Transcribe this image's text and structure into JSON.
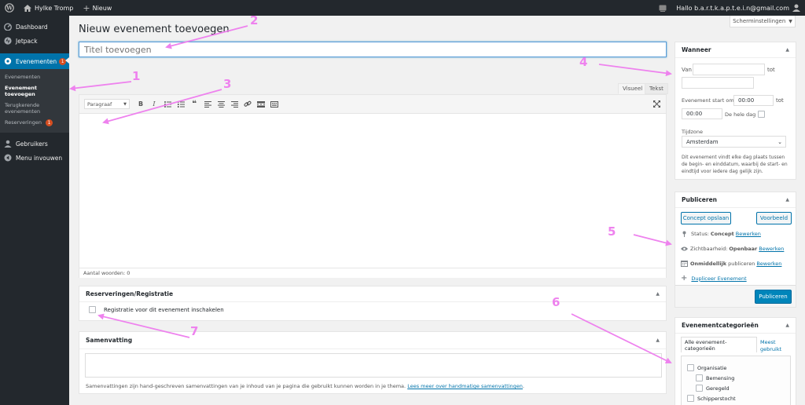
{
  "admin_bar": {
    "site_name": "Hylke Tromp",
    "new_label": "Nieuw",
    "greeting": "Hallo b.a.r.t.k.a.p.t.e.i.n@gmail.com"
  },
  "sidebar": {
    "items": [
      {
        "label": "Dashboard"
      },
      {
        "label": "Jetpack"
      },
      {
        "label": "Evenementen",
        "badge": "1"
      },
      {
        "label": "Gebruikers"
      },
      {
        "label": "Menu invouwen"
      }
    ],
    "submenu": [
      {
        "label": "Evenementen"
      },
      {
        "label": "Evenement toevoegen"
      },
      {
        "label": "Terugkerende evenementen"
      },
      {
        "label": "Reserveringen",
        "badge": "1"
      }
    ]
  },
  "main": {
    "page_title": "Nieuw evenement toevoegen",
    "screen_options": "Scherminstellingen",
    "title_placeholder": "Titel toevoegen"
  },
  "editor": {
    "tab_visual": "Visueel",
    "tab_text": "Tekst",
    "format": "Paragraaf",
    "word_count": "Aantal woorden: 0"
  },
  "reservations_box": {
    "title": "Reserveringen/Registratie",
    "checkbox_label": "Registratie voor dit evenement inschakelen"
  },
  "summary_box": {
    "title": "Samenvatting",
    "help_text": "Samenvattingen zijn hand-geschreven samenvattingen van je inhoud van je pagina die gebruikt kunnen worden in je thema.",
    "help_link": "Lees meer over handmatige samenvattingen"
  },
  "when_box": {
    "title": "Wanneer",
    "from_label": "Van",
    "to_label": "tot",
    "start_label": "Evenement start om",
    "start_time": "00:00",
    "end_time": "00:00",
    "all_day_label": "De hele dag",
    "timezone_label": "Tijdzone",
    "timezone_value": "Amsterdam",
    "note": "Dit evenement vindt elke dag plaats tussen de begin- en einddatum, waarbij de start- en eindtijd voor iedere dag gelijk zijn."
  },
  "publish_box": {
    "title": "Publiceren",
    "save_draft": "Concept opslaan",
    "preview": "Voorbeeld",
    "status_label": "Status:",
    "status_value": "Concept",
    "visibility_label": "Zichtbaarheid:",
    "visibility_value": "Openbaar",
    "publish_time_value": "Onmiddellijk",
    "publish_time_label": "publiceren",
    "edit_link": "Bewerken",
    "duplicate_link": "Dupliceer Evenement",
    "publish_button": "Publiceren"
  },
  "categories_box": {
    "title": "Evenementcategorieën",
    "tab_all": "Alle evenement-categorieën",
    "tab_most_used": "Meest gebruikt",
    "items": [
      {
        "label": "Organisatie"
      },
      {
        "label": "Bemensing"
      },
      {
        "label": "Geregeld"
      },
      {
        "label": "Schipperstocht"
      }
    ]
  },
  "annotations": [
    "1",
    "2",
    "3",
    "4",
    "5",
    "6",
    "7"
  ],
  "colors": {
    "accent": "#0073aa",
    "admin_dark": "#23282d",
    "annotation": "#ee82ee",
    "badge": "#d54e21"
  }
}
